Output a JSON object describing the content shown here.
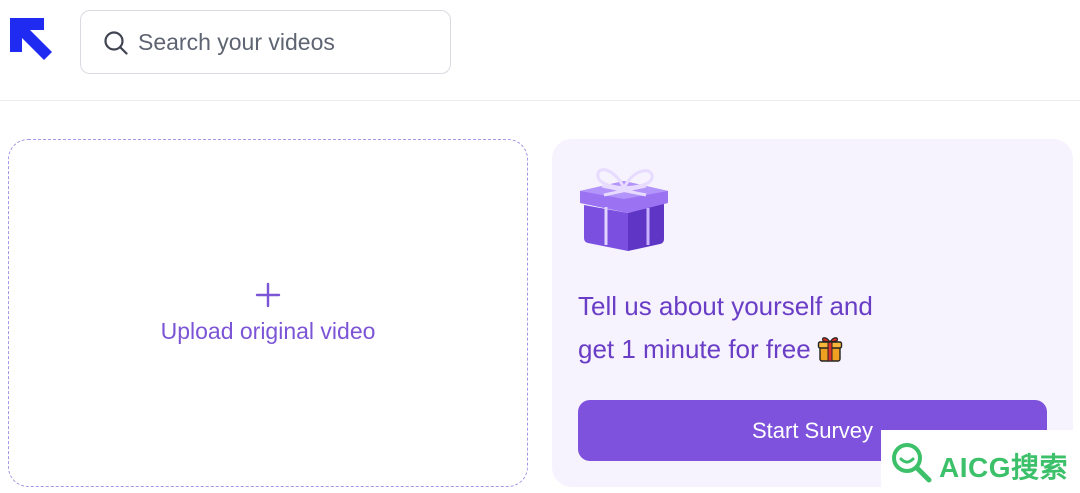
{
  "header": {
    "logo_icon": "arrow-up-left-logo",
    "search": {
      "placeholder": "Search your videos",
      "value": "",
      "icon": "search-icon"
    }
  },
  "upload": {
    "plus_icon": "plus-icon",
    "label": "Upload original video"
  },
  "promo": {
    "illustration": "gift-box-icon",
    "line1": "Tell us about yourself and",
    "line2": "get 1 minute for free",
    "emoji": "gift-emoji",
    "button_label": "Start Survey"
  },
  "watermark": {
    "text": "AICG搜索"
  },
  "colors": {
    "brand_blue": "#1f2bf0",
    "accent_purple": "#7e52dc",
    "promo_bg": "#f6f2fe",
    "text_purple": "#6a3dc6",
    "watermark_green": "#3cc06a"
  }
}
